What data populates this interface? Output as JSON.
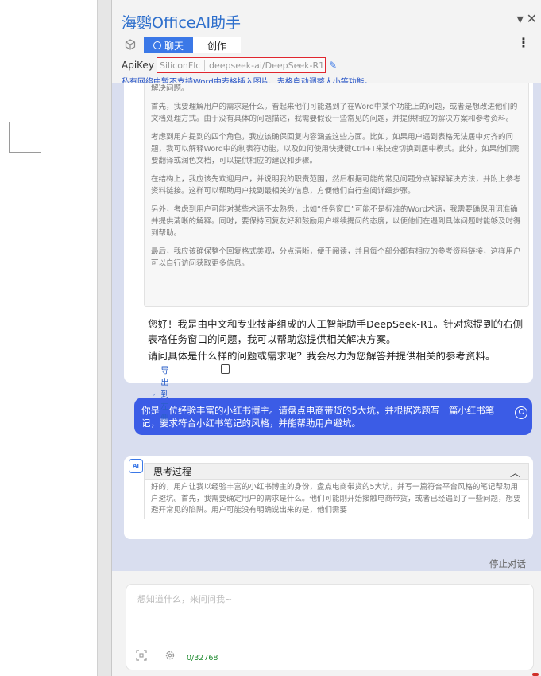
{
  "pane": {
    "title": "海鹦OfficeAI助手",
    "chevron_glyph": "▼",
    "close_glyph": "✕",
    "more_glyph": "⋮"
  },
  "tabs": {
    "chat_label": "聊天",
    "create_label": "创作"
  },
  "apikey": {
    "label": "ApiKey",
    "provider": "SiliconFlc",
    "model": "deepseek-ai/DeepSeek-R1",
    "edit_glyph": "✎"
  },
  "notice": "私有网络中暂不支持Word中表格插入图片、表格自动调整大小等功能。",
  "conversation": {
    "think_1_paragraphs": [
      "务窗口起用户能入内容并与系统交互。他可能是在使用Word专家、翻译专家、文档润色专家或文案编辑案帮助解决问题。",
      "首先，我要理解用户的需求是什么。看起来他们可能遇到了在Word中某个功能上的问题，或者是想改进他们的文档处理方式。由于没有具体的问题描述，我需要假设一些常见的问题，并提供相应的解决方案和参考资料。",
      "考虑到用户提到的四个角色，我应该确保回复内容涵盖这些方面。比如，如果用户遇到表格无法居中对齐的问题，我可以解释Word中的制表符功能，以及如何使用快捷键Ctrl+T来快速切换到居中模式。此外，如果他们需要翻译或润色文档，可以提供相应的建议和步骤。",
      "在结构上，我应该先欢迎用户，并说明我的职责范围，然后根据可能的常见问题分点解释解决方法，并附上参考资料链接。这样可以帮助用户找到最相关的信息，方便他们自行查阅详细步骤。",
      "另外，考虑到用户可能对某些术语不太熟悉，比如“任务窗口”可能不是标准的Word术语，我需要确保用词准确并提供清晰的解释。同时，要保持回复友好和鼓励用户继续提问的态度，以便他们在遇到具体问题时能够及时得到帮助。",
      "最后，我应该确保整个回复格式美观，分点清晰，便于阅读，并且每个部分都有相应的参考资料链接，这样用户可以自行访问获取更多信息。"
    ],
    "answer_1_p1": "您好！我是由中文和专业技能组成的人工智能助手DeepSeek-R1。针对您提到的右侧表格任务窗口的问题，我可以帮助您提供相关解决方案。",
    "answer_1_p2": "请问具体是什么样的问题或需求呢？我会尽力为您解答并提供相关的参考资料。",
    "export_label": "导出到左侧",
    "user_message": "你是一位经验丰富的小红书博主。请盘点电商带货的5大坑，并根据选题写一篇小红书笔记，要求符合小红书笔记的风格，并能帮助用户避坑。",
    "ai_badge": "AI",
    "think_2_header": "思考过程",
    "think_2_text": "好的，用户让我以经验丰富的小红书博主的身份，盘点电商带货的5大坑，并写一篇符合平台风格的笔记帮助用户避坑。首先，我需要确定用户的需求是什么。他们可能刚开始接触电商带货，或者已经遇到了一些问题，想要避开常见的陷阱。用户可能没有明确说出来的是，他们需要"
  },
  "stop_label": "停止对话",
  "input": {
    "placeholder": "想知道什么，来问问我~",
    "value": "",
    "char_counter": "0/32768"
  },
  "colors": {
    "brand_blue": "#3b78e7",
    "title_blue": "#2e6fcc",
    "user_bubble": "#3b5ce6",
    "chat_bg": "#d9deef",
    "progress_green": "#2ab27b",
    "apikey_highlight": "#e0262e"
  },
  "icons": {
    "cube": "cube-icon",
    "chat": "chat-bubble-icon",
    "edit": "edit-icon",
    "export": "export-icon",
    "copy": "copy-icon",
    "user": "user-avatar-icon",
    "chevron_up": "chevron-up-icon",
    "screenshot": "screenshot-icon",
    "settings": "settings-icon"
  }
}
